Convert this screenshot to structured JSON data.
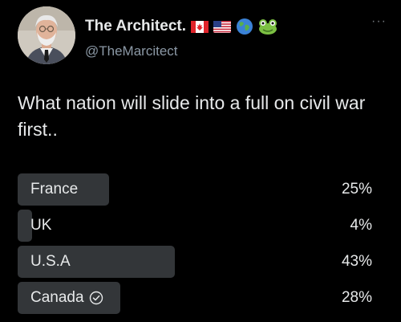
{
  "author": {
    "display_name": "The Architect.",
    "handle": "@TheMarcitect",
    "name_emojis": [
      "canada-flag-icon",
      "us-flag-icon",
      "globe-icon",
      "frog-icon"
    ]
  },
  "more_label": "···",
  "tweet": {
    "text": "What nation will slide into a full on civil war first.."
  },
  "poll": {
    "options": [
      {
        "label": "France",
        "percent_label": "25%",
        "percent": 25,
        "selected": false
      },
      {
        "label": "UK",
        "percent_label": "4%",
        "percent": 4,
        "selected": false
      },
      {
        "label": "U.S.A",
        "percent_label": "43%",
        "percent": 43,
        "selected": false
      },
      {
        "label": "Canada",
        "percent_label": "28%",
        "percent": 28,
        "selected": true
      }
    ]
  },
  "colors": {
    "background": "#000000",
    "text": "#e7e9ea",
    "secondary_text": "#8b98a5",
    "poll_bar": "#333639"
  }
}
